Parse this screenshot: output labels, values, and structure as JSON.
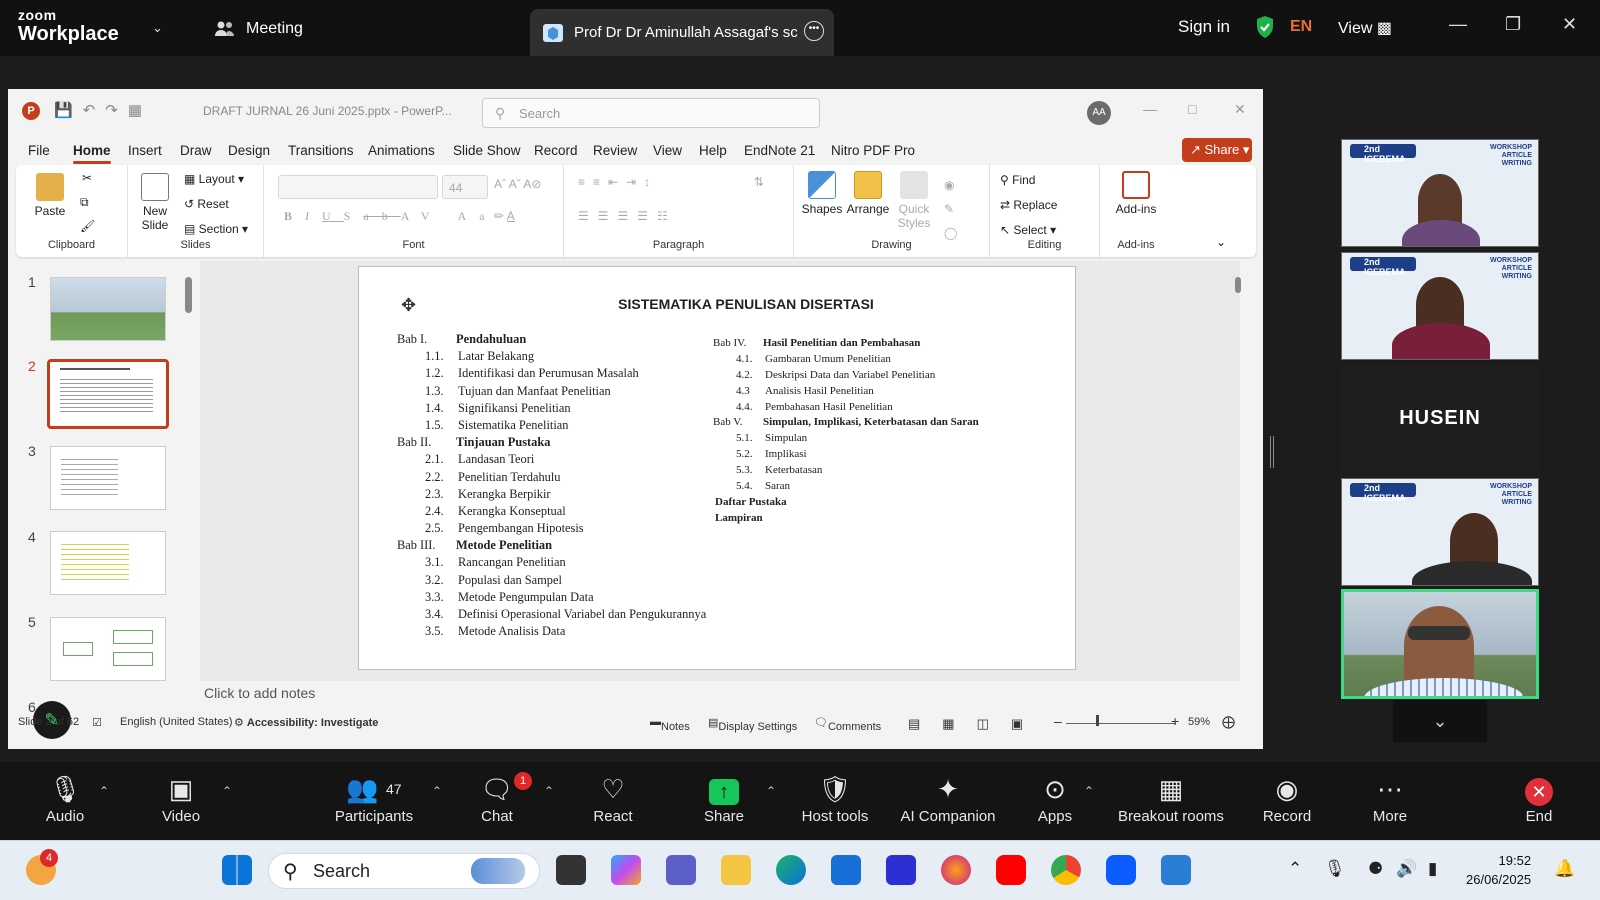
{
  "zoom": {
    "logo_line1": "zoom",
    "logo_line2": "Workplace",
    "meeting_label": "Meeting",
    "share_tab_title": "Prof Dr Dr Aminullah Assagaf's sc",
    "sign_in": "Sign in",
    "language": "EN",
    "view": "View"
  },
  "powerpoint": {
    "filename": "DRAFT JURNAL 26 Juni 2025.pptx - PowerP...",
    "search_placeholder": "Search",
    "avatar_initials": "AA",
    "share_label": "Share",
    "menu": [
      "File",
      "Home",
      "Insert",
      "Draw",
      "Design",
      "Transitions",
      "Animations",
      "Slide Show",
      "Record",
      "Review",
      "View",
      "Help",
      "EndNote 21",
      "Nitro PDF Pro"
    ],
    "active_menu": "Home",
    "ribbon": {
      "clipboard": {
        "paste": "Paste",
        "label": "Clipboard"
      },
      "slides": {
        "new_slide": "New Slide",
        "layout": "Layout",
        "reset": "Reset",
        "section": "Section",
        "label": "Slides"
      },
      "font": {
        "size": "44",
        "label": "Font"
      },
      "paragraph": {
        "label": "Paragraph"
      },
      "drawing": {
        "shapes": "Shapes",
        "arrange": "Arrange",
        "quick_styles": "Quick Styles",
        "label": "Drawing"
      },
      "editing": {
        "find": "Find",
        "replace": "Replace",
        "select": "Select",
        "label": "Editing"
      },
      "addins": {
        "addins": "Add-ins",
        "label": "Add-ins"
      }
    },
    "thumbnails": [
      "1",
      "2",
      "3",
      "4",
      "5",
      "6"
    ],
    "selected_slide": "2",
    "slide": {
      "title": "SISTEMATIKA PENULISAN DISERTASI",
      "left_column": [
        {
          "num": "Bab I.",
          "text": "Pendahuluan",
          "level": 0
        },
        {
          "num": "1.1.",
          "text": "Latar Belakang",
          "level": 1
        },
        {
          "num": "1.2.",
          "text": "Identifikasi  dan Perumusan  Masalah",
          "level": 1
        },
        {
          "num": "1.3.",
          "text": "Tujuan  dan Manfaat  Penelitian",
          "level": 1
        },
        {
          "num": "1.4.",
          "text": "Signifikansi  Penelitian",
          "level": 1
        },
        {
          "num": "1.5.",
          "text": "Sistematika  Penelitian",
          "level": 1
        },
        {
          "num": "Bab II.",
          "text": "Tinjauan Pustaka",
          "level": 0
        },
        {
          "num": "2.1.",
          "text": "Landasan Teori",
          "level": 1
        },
        {
          "num": "2.2.",
          "text": "Penelitian Terdahulu",
          "level": 1
        },
        {
          "num": "2.3.",
          "text": "Kerangka  Berpikir",
          "level": 1
        },
        {
          "num": "2.4.",
          "text": "Kerangka  Konseptual",
          "level": 1
        },
        {
          "num": "2.5.",
          "text": "Pengembangan  Hipotesis",
          "level": 1
        },
        {
          "num": "Bab III.",
          "text": "Metode Penelitian",
          "level": 0
        },
        {
          "num": "3.1.",
          "text": "Rancangan Penelitian",
          "level": 1
        },
        {
          "num": "3.2.",
          "text": "Populasi dan Sampel",
          "level": 1
        },
        {
          "num": "3.3.",
          "text": "Metode  Pengumpulan Data",
          "level": 1
        },
        {
          "num": "3.4.",
          "text": "Definisi Operasional Variabel dan Pengukurannya",
          "level": 1
        },
        {
          "num": "3.5.",
          "text": "Metode  Analisis Data",
          "level": 1
        }
      ],
      "right_column": [
        {
          "num": "Bab IV.",
          "text": "Hasil Penelitian dan Pembahasan",
          "level": 0
        },
        {
          "num": "4.1.",
          "text": "Gambaran Umum Penelitian",
          "level": 1
        },
        {
          "num": "4.2.",
          "text": "Deskripsi Data dan Variabel Penelitian",
          "level": 1
        },
        {
          "num": "4.3",
          "text": "Analisis Hasil Penelitian",
          "level": 1
        },
        {
          "num": "4.4.",
          "text": "Pembahasan Hasil Penelitian",
          "level": 1
        },
        {
          "num": "Bab V.",
          "text": "Simpulan, Implikasi, Keterbatasan dan Saran",
          "level": 0
        },
        {
          "num": "5.1.",
          "text": "Simpulan",
          "level": 1
        },
        {
          "num": "5.2.",
          "text": "Implikasi",
          "level": 1
        },
        {
          "num": "5.3.",
          "text": "Keterbatasan",
          "level": 1
        },
        {
          "num": "5.4.",
          "text": "Saran",
          "level": 1
        },
        {
          "num": "",
          "text": "Daftar Pustaka",
          "level": 2
        },
        {
          "num": "",
          "text": "Lampiran",
          "level": 2
        }
      ]
    },
    "notes_placeholder": "Click to add notes",
    "status": {
      "slide_count": "Slide 2 of 62",
      "language": "English (United States)",
      "accessibility": "Accessibility: Investigate",
      "notes": "Notes",
      "display_settings": "Display Settings",
      "comments": "Comments",
      "zoom": "59%"
    }
  },
  "participants_panel": {
    "banner_left": "2nd ICEBEMA",
    "banner_right": "WORKSHOP ARTICLE WRITING",
    "name_tile": "HUSEIN"
  },
  "toolbar": [
    {
      "label": "Audio",
      "icon": "microphone-icon"
    },
    {
      "label": "Video",
      "icon": "camera-icon"
    },
    {
      "label": "Participants",
      "icon": "participants-icon",
      "count": "47"
    },
    {
      "label": "Chat",
      "icon": "chat-icon",
      "badge": "1"
    },
    {
      "label": "React",
      "icon": "heart-icon"
    },
    {
      "label": "Share",
      "icon": "share-icon"
    },
    {
      "label": "Host tools",
      "icon": "shield-icon"
    },
    {
      "label": "AI Companion",
      "icon": "sparkle-icon"
    },
    {
      "label": "Apps",
      "icon": "apps-icon"
    },
    {
      "label": "Breakout rooms",
      "icon": "breakout-icon"
    },
    {
      "label": "Record",
      "icon": "record-icon"
    },
    {
      "label": "More",
      "icon": "more-icon"
    },
    {
      "label": "End",
      "icon": "end-icon"
    }
  ],
  "taskbar": {
    "search": "Search",
    "weather_badge": "4",
    "time": "19:52",
    "date": "26/06/2025"
  },
  "colors": {
    "ppt_accent": "#c43e1c",
    "zoom_share_green": "#17c65a",
    "active_speaker": "#3ddc84"
  }
}
